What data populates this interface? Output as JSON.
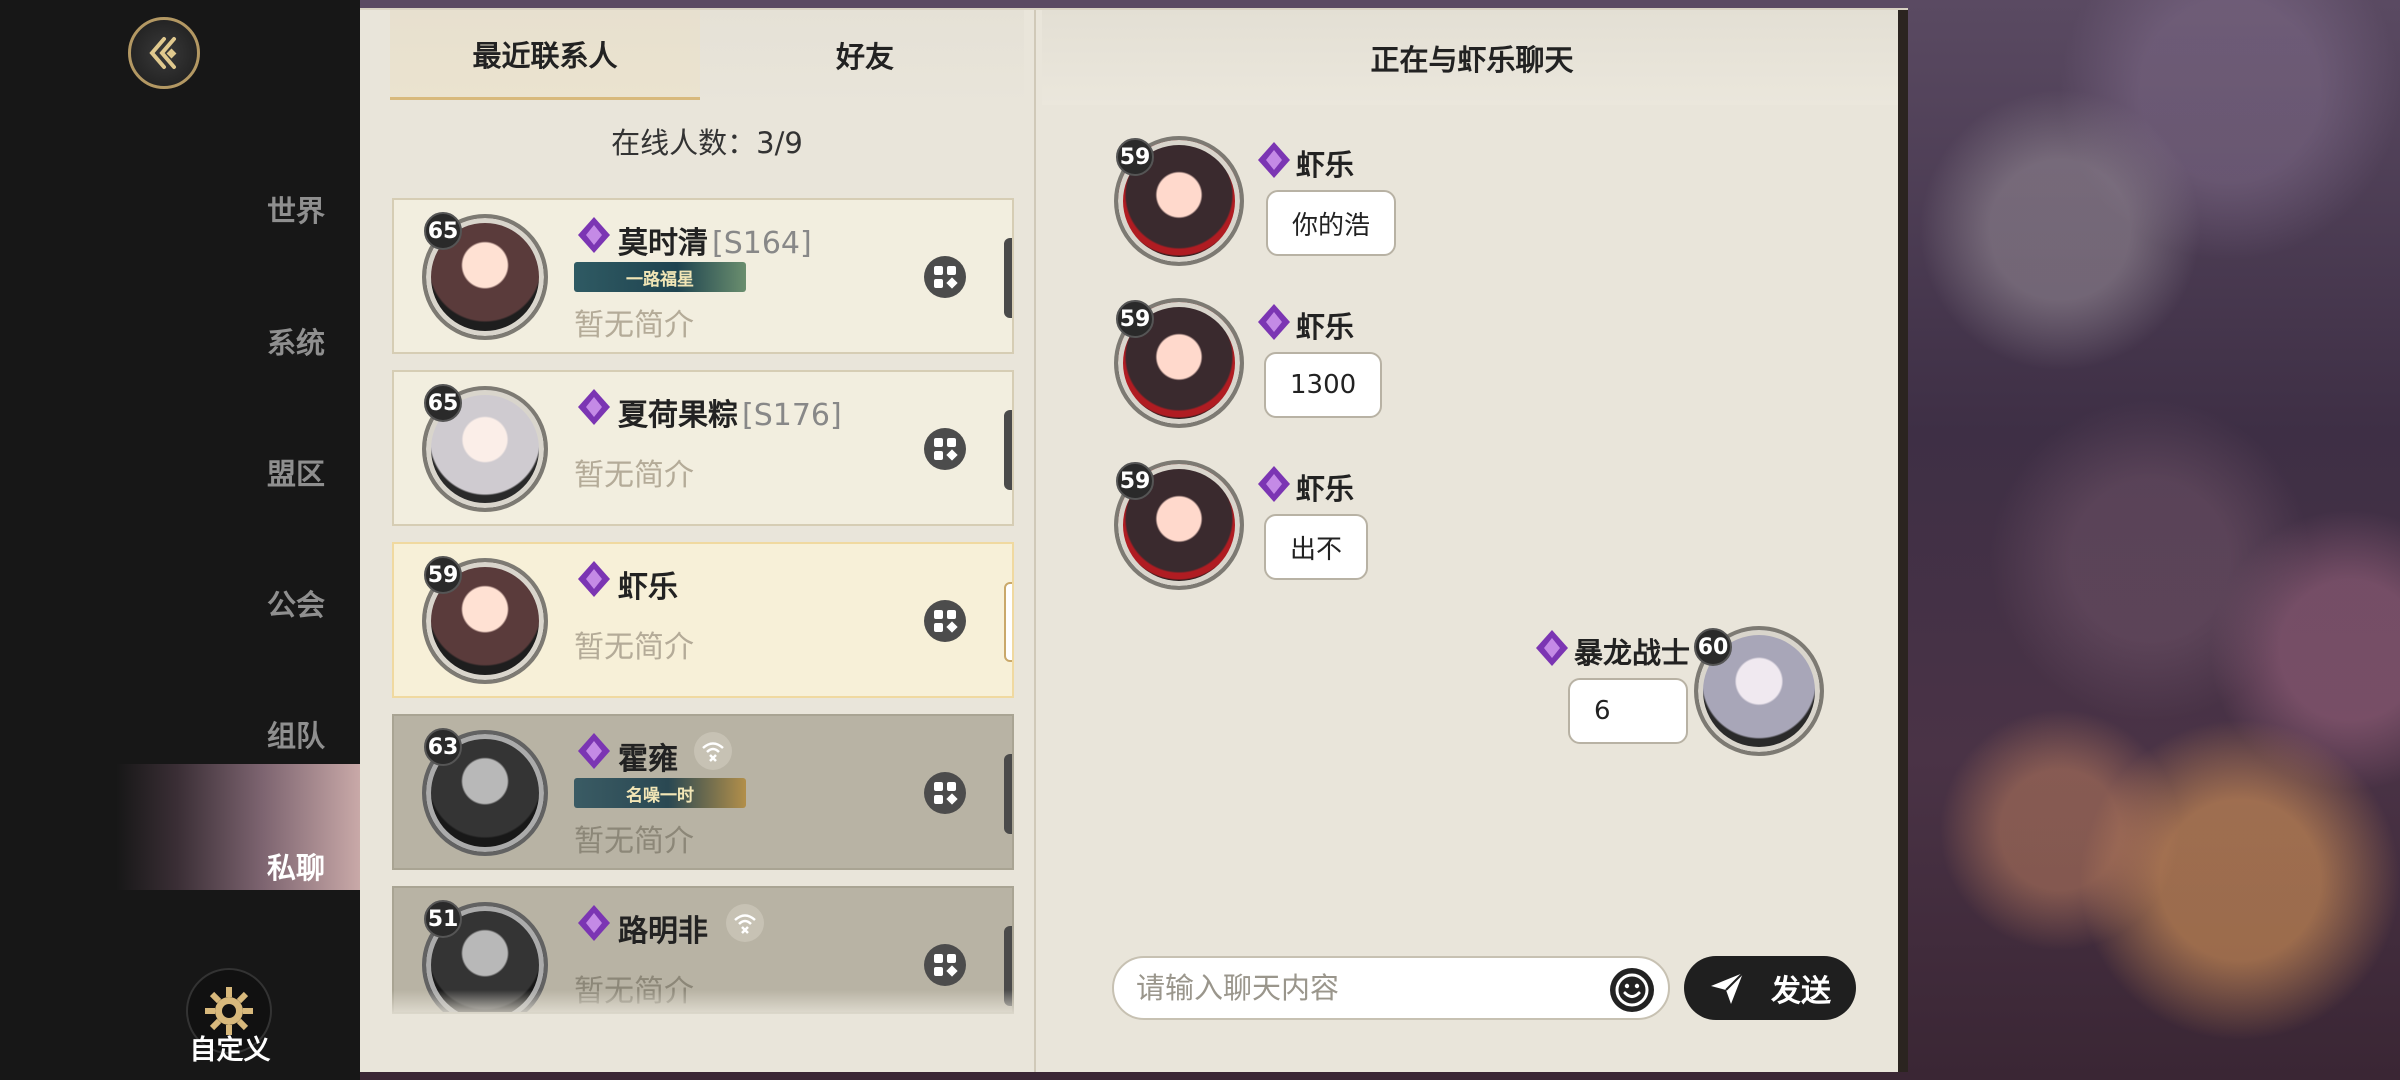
{
  "sidebar": {
    "nav": [
      {
        "label": "世界"
      },
      {
        "label": "系统"
      },
      {
        "label": "盟区"
      },
      {
        "label": "公会"
      },
      {
        "label": "组队"
      },
      {
        "label": "私聊"
      }
    ],
    "custom_label": "自定义",
    "active_index": 5
  },
  "tabs": {
    "recent": "最近联系人",
    "friends": "好友"
  },
  "online": {
    "label": "在线人数：",
    "count": "3/9"
  },
  "contacts": [
    {
      "level": "65",
      "name": "莫时清",
      "server": "[S164]",
      "title": "一路福星",
      "bio": "暂无简介",
      "online": true
    },
    {
      "level": "65",
      "name": "夏荷果粽",
      "server": "[S176]",
      "title": "",
      "bio": "暂无简介",
      "online": true
    },
    {
      "level": "59",
      "name": "虾乐",
      "server": "",
      "title": "",
      "bio": "暂无简介",
      "online": true,
      "selected": true
    },
    {
      "level": "63",
      "name": "霍雍",
      "server": "",
      "title": "名噪一时",
      "bio": "暂无简介",
      "online": false
    },
    {
      "level": "51",
      "name": "路明非",
      "server": "",
      "title": "",
      "bio": "暂无简介",
      "online": false
    }
  ],
  "chat": {
    "header": "正在与虾乐聊天",
    "messages": [
      {
        "level": "59",
        "sender": "虾乐",
        "text": "你的浩"
      },
      {
        "level": "59",
        "sender": "虾乐",
        "text": "1300"
      },
      {
        "level": "59",
        "sender": "虾乐",
        "text": "出不"
      },
      {
        "level": "60",
        "sender": "暴龙战士",
        "text": "6",
        "mine": true
      }
    ],
    "input_placeholder": "请输入聊天内容",
    "send_label": "发送"
  },
  "colors": {
    "panel_bg": "#e9e5da",
    "sidebar_bg": "#171717",
    "accent_gold": "#d8b97c",
    "vip_purple": "#8a3fc0"
  }
}
